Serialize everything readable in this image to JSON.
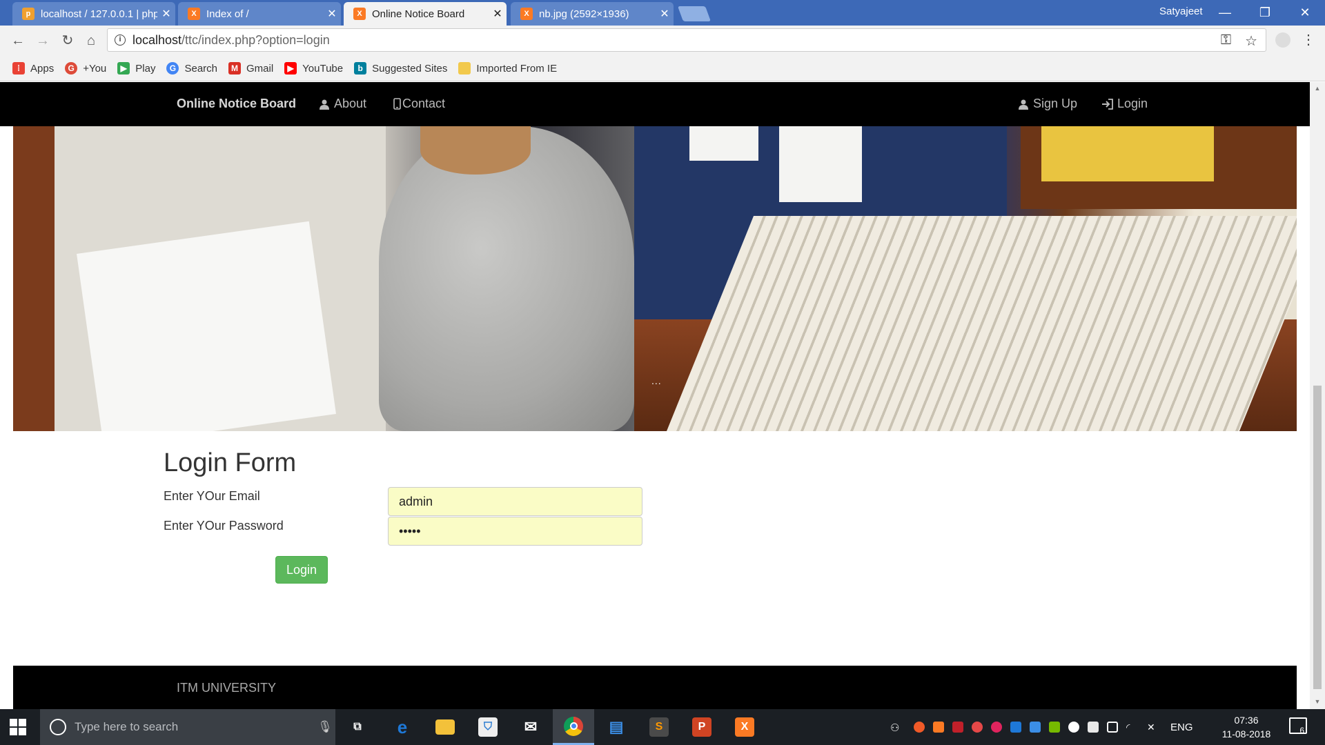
{
  "browser": {
    "tabs": [
      {
        "title": "localhost / 127.0.0.1 | php",
        "favicon": "phpmyadmin-icon",
        "active": false
      },
      {
        "title": "Index of /",
        "favicon": "xampp-icon",
        "active": false
      },
      {
        "title": "Online Notice Board",
        "favicon": "xampp-icon",
        "active": true
      },
      {
        "title": "nb.jpg (2592×1936)",
        "favicon": "xampp-icon",
        "active": false
      }
    ],
    "profile_name": "Satyajeet",
    "url_host": "localhost",
    "url_path": "/ttc/index.php?option=login",
    "bookmarks": [
      {
        "label": "Apps",
        "icon": "apps-grid-icon",
        "color": "#e94235"
      },
      {
        "label": "+You",
        "icon": "google-plus-icon",
        "color": "#dd4b39"
      },
      {
        "label": "Play",
        "icon": "play-store-icon",
        "color": "#34a853"
      },
      {
        "label": "Search",
        "icon": "google-icon",
        "color": "#4285f4"
      },
      {
        "label": "Gmail",
        "icon": "gmail-icon",
        "color": "#d93025"
      },
      {
        "label": "YouTube",
        "icon": "youtube-icon",
        "color": "#ff0000"
      },
      {
        "label": "Suggested Sites",
        "icon": "bing-icon",
        "color": "#00809d"
      },
      {
        "label": "Imported From IE",
        "icon": "folder-icon",
        "color": "#f2c94c"
      }
    ]
  },
  "site": {
    "brand": "Online Notice Board",
    "nav": {
      "about": "About",
      "contact": "Contact",
      "signup": "Sign Up",
      "login": "Login"
    },
    "hero_dots": "..."
  },
  "login_form": {
    "title": "Login Form",
    "email_label": "Enter YOur Email",
    "password_label": "Enter YOur Password",
    "email_value": "admin",
    "password_value": "•••••",
    "submit_label": "Login"
  },
  "footer": {
    "text": "ITM UNIVERSITY"
  },
  "taskbar": {
    "search_placeholder": "Type here to search",
    "apps": [
      {
        "name": "task-view-icon",
        "glyph": "⧉",
        "color": "#1b1f24"
      },
      {
        "name": "edge-icon",
        "glyph": "e",
        "color": "#1e78d7"
      },
      {
        "name": "file-explorer-icon",
        "glyph": "▭",
        "color": "#f3c13a"
      },
      {
        "name": "store-icon",
        "glyph": "⛉",
        "color": "#2d7dd2"
      },
      {
        "name": "mail-icon",
        "glyph": "✉",
        "color": "#5a6068"
      },
      {
        "name": "chrome-icon",
        "glyph": "◉",
        "color": "#db4437"
      },
      {
        "name": "laptop-app-icon",
        "glyph": "▤",
        "color": "#3b8ee6"
      },
      {
        "name": "sublime-text-icon",
        "glyph": "S",
        "color": "#ff9800"
      },
      {
        "name": "powerpoint-icon",
        "glyph": "P",
        "color": "#d04423"
      },
      {
        "name": "xampp-icon",
        "glyph": "X",
        "color": "#fb7a24"
      }
    ],
    "language": "ENG",
    "time": "07:36",
    "date": "11-08-2018",
    "notification_count": "6"
  },
  "colors": {
    "titlebar": "#3d69b7",
    "site_nav": "#000000",
    "login_button": "#5cb85c",
    "autofill_input": "#fafcc6"
  }
}
